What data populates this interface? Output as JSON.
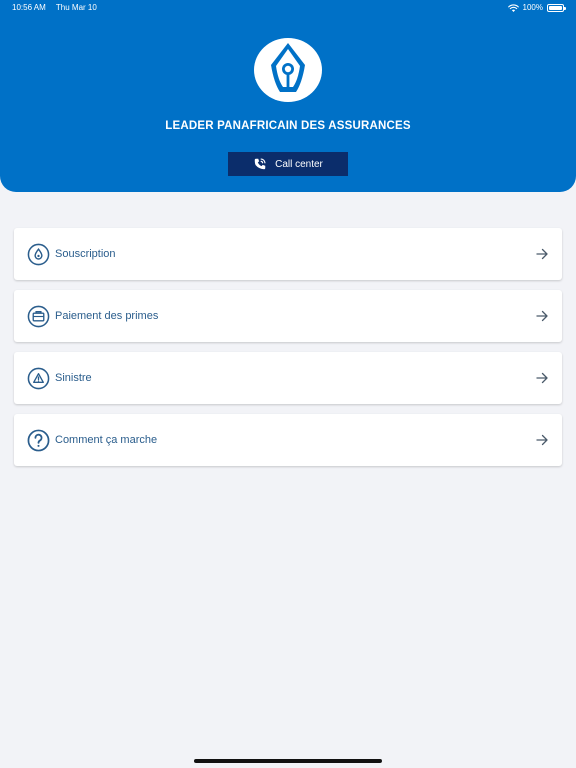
{
  "status_bar": {
    "time": "10:56 AM",
    "date": "Thu Mar 10",
    "battery": "100%",
    "icons": [
      "wifi-icon",
      "battery-icon"
    ]
  },
  "header": {
    "logo_icon": "pen-nib-logo",
    "org_name": "LEADER PANAFRICAIN DES ASSURANCES",
    "call_button_label": "Call center",
    "call_icon": "phone-call-icon"
  },
  "menu": [
    {
      "label": "Souscription",
      "icon": "droplet-icon"
    },
    {
      "label": "Paiement des primes",
      "icon": "briefcase-icon"
    },
    {
      "label": "Sinistre",
      "icon": "warning-icon"
    },
    {
      "label": "Comment ça marche",
      "icon": "help-icon"
    }
  ],
  "colors": {
    "header_bg": "#0071c7",
    "call_button_bg": "#0b2d6b",
    "menu_text": "#2a5d8c",
    "page_bg": "#f2f3f7"
  }
}
